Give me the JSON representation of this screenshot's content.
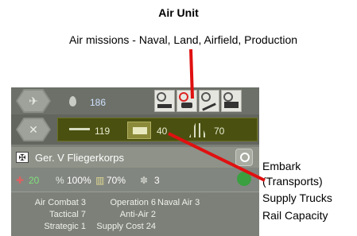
{
  "header": {
    "title": "Air Unit",
    "subtitle": "Air missions - Naval, Land, Airfield, Production"
  },
  "unit_panel": {
    "fuel_value": "186",
    "supply_band": {
      "air_supply": "119",
      "supply_trucks": "40",
      "rail_capacity": "70"
    },
    "unit_name": "Ger. V Fliegerkorps",
    "stats": {
      "strength": "20",
      "efficiency": "100%",
      "readiness": "70%",
      "experience": "3"
    },
    "combat_values": {
      "air_combat_label": "Air Combat",
      "air_combat": "3",
      "tactical_label": "Tactical",
      "tactical": "7",
      "strategic_label": "Strategic",
      "strategic": "1",
      "operation_label": "Operation",
      "operation": "6",
      "anti_air_label": "Anti-Air",
      "anti_air": "2",
      "supply_cost_label": "Supply Cost",
      "supply_cost": "24",
      "naval_air_label": "Naval Air",
      "naval_air": "3"
    }
  },
  "annotations": {
    "line1": "Embark",
    "line2": "(Transports)",
    "line3": "Supply Trucks",
    "line4": "Rail Capacity"
  },
  "colors": {
    "pointer": "#e01010",
    "fuel_text": "#cfe0ff",
    "strength_text": "#7ee07a"
  }
}
